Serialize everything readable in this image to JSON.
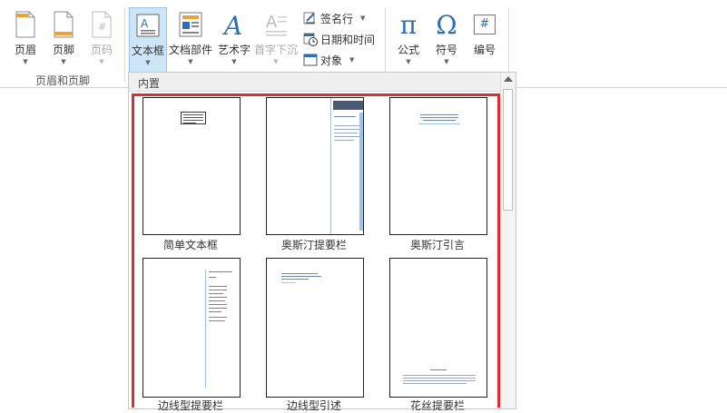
{
  "ribbon": {
    "header_footer_group": {
      "label": "页眉和页脚",
      "buttons": [
        {
          "label": "页眉",
          "icon": "header-page-icon",
          "disabled": false
        },
        {
          "label": "页脚",
          "icon": "footer-page-icon",
          "disabled": false
        },
        {
          "label": "页码",
          "icon": "page-number-icon",
          "disabled": true
        }
      ]
    },
    "text_group": {
      "buttons": [
        {
          "label": "文本框",
          "icon": "text-box-icon",
          "active": true
        },
        {
          "label": "文档部件",
          "icon": "quick-parts-icon"
        },
        {
          "label": "艺术字",
          "icon": "wordart-icon"
        },
        {
          "label": "首字下沉",
          "icon": "drop-cap-icon",
          "disabled": true
        }
      ],
      "small_buttons": [
        {
          "label": "签名行",
          "icon": "signature-line-icon",
          "has_dropdown": true
        },
        {
          "label": "日期和时间",
          "icon": "date-time-icon",
          "has_dropdown": false
        },
        {
          "label": "对象",
          "icon": "object-icon",
          "has_dropdown": true
        }
      ]
    },
    "symbols_group": {
      "buttons": [
        {
          "label": "公式",
          "glyph": "π",
          "icon": "equation-icon"
        },
        {
          "label": "符号",
          "glyph": "Ω",
          "icon": "symbol-icon"
        },
        {
          "label": "编号",
          "glyph": "#",
          "icon": "numbering-icon"
        }
      ]
    }
  },
  "gallery": {
    "section_title": "内置",
    "items": [
      {
        "label": "简单文本框"
      },
      {
        "label": "奥斯汀提要栏"
      },
      {
        "label": "奥斯汀引言"
      },
      {
        "label": "边线型提要栏"
      },
      {
        "label": "边线型引述"
      },
      {
        "label": "花丝提要栏"
      }
    ]
  },
  "colors": {
    "active_button_bg": "#cde6f7",
    "highlight_border": "#d9302f",
    "icon_blue": "#2f6db5",
    "icon_orange": "#e8a33a"
  }
}
